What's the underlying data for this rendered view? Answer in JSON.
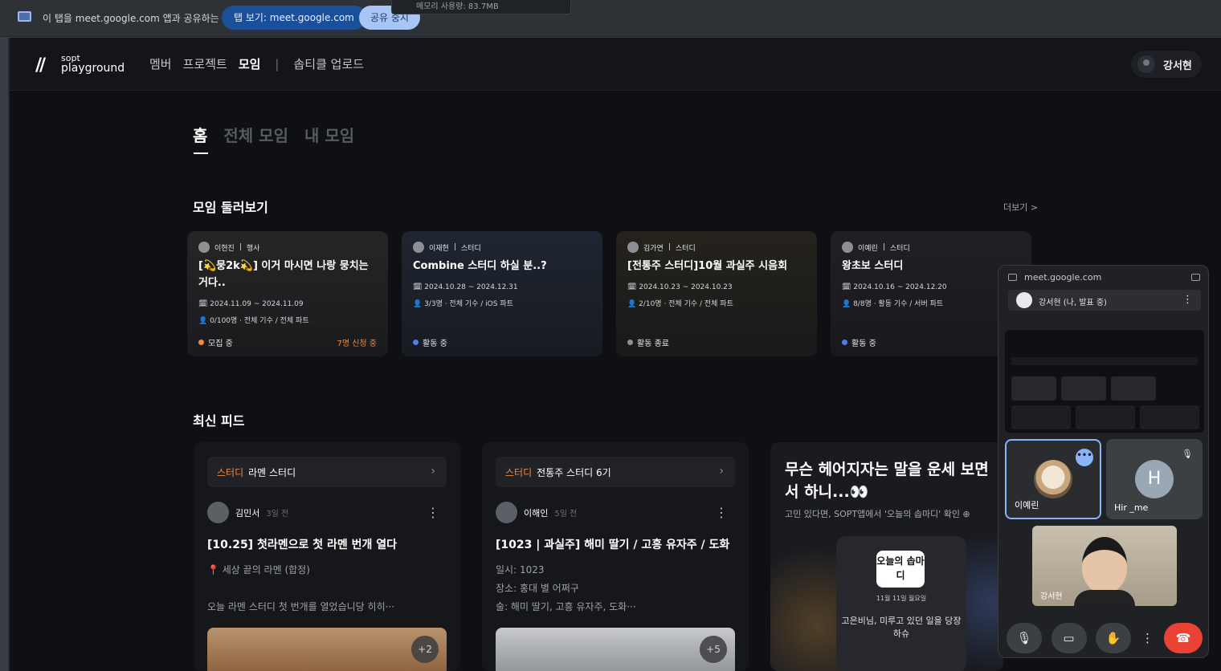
{
  "share_bar": {
    "text": "이 탭을 meet.google.com 앱과 공유하는 중",
    "view_tab_button": "탭 보기: meet.google.com",
    "stop_button": "공유 중지",
    "memory_tooltip": "메모리 사용량: 83.7MB"
  },
  "nav": {
    "logo_top": "sopt",
    "logo_bottom": "playground",
    "items": [
      "멤버",
      "프로젝트",
      "모임",
      "|",
      "솝티클 업로드"
    ],
    "active": "모임",
    "user_name": "강서현"
  },
  "tabs": [
    "홈",
    "전체 모임",
    "내 모임"
  ],
  "groups_section": {
    "title": "모임 둘러보기",
    "more": "더보기 >",
    "cards": [
      {
        "author": "이현진",
        "category": "행사",
        "title": "[💫뭉2k💫] 이거 마시면 나랑 뭉치는 거다..",
        "dates": "2024.11.09 ~ 2024.11.09",
        "members": "0/100명 · 전체 기수 / 전체 파트",
        "status": "모집 중",
        "status_color": "#f28a3a",
        "apply": "7명 신청 중",
        "bg": "#3b3a36"
      },
      {
        "author": "이재현",
        "category": "스터디",
        "title": "Combine 스터디 하실 분..?",
        "dates": "2024.10.28 ~ 2024.12.31",
        "members": "3/3명 · 전체 기수 / iOS 파트",
        "status": "활동 중",
        "status_color": "#4d7cf2",
        "apply": "",
        "bg": "#2c3a4f"
      },
      {
        "author": "김가연",
        "category": "스터디",
        "title": "[전통주 스터디]10월 과실주 시음회",
        "dates": "2024.10.23 ~ 2024.10.23",
        "members": "2/10명 · 전체 기수 / 전체 파트",
        "status": "활동 종료",
        "status_color": "#8e9198",
        "apply": "",
        "bg": "#3a3321"
      },
      {
        "author": "이예린",
        "category": "스터디",
        "title": "왕초보 스터디",
        "dates": "2024.10.16 ~ 2024.12.20",
        "members": "8/8명 · 활동 기수 / 서버 파트",
        "status": "활동 중",
        "status_color": "#4d7cf2",
        "apply": "",
        "bg": "#2d2f36"
      }
    ]
  },
  "feed_section": {
    "title": "최신 피드",
    "posts": [
      {
        "category": "스터디",
        "group": "라멘 스터디",
        "author": "김민서",
        "ago": "3일 전",
        "title": "[10.25] 첫라멘으로 첫 라멘 번개 열다",
        "line1": "📍 세상 끝의 라멘 (합정)",
        "line2": "오늘 라멘 스터디 첫 번개를 열었습니당 히히···",
        "line3": "",
        "plus": "+2"
      },
      {
        "category": "스터디",
        "group": "전통주 스터디 6기",
        "author": "이해인",
        "ago": "5일 전",
        "title": "[1023 | 과실주] 해미 딸기 / 고흥 유자주 / 도화",
        "line1": "일시: 1023",
        "line2": "장소: 홍대 별 어쩌구",
        "line3": "술: 해미 딸기, 고흥 유자주, 도화···",
        "plus": "+5"
      }
    ],
    "ad": {
      "headline": "무슨 헤어지자는 말을 운세 보면서 하니...👀",
      "sub": "고민 있다면, SOPT앱에서 '오늘의 솝마디' 확인 ⊕",
      "badge": "오늘의 솝마디",
      "date": "11월 11일 월요일",
      "message": "고은비님, 미루고 있던 일을 당장 하슈"
    }
  },
  "meet": {
    "url": "meet.google.com",
    "presenter": "강서현 (나, 발표 중)",
    "tiles": [
      {
        "name": "이예린",
        "initial": ""
      },
      {
        "name": "Hir _me",
        "initial": "H"
      }
    ],
    "self_label": "강서현",
    "controls": [
      "mic",
      "camera",
      "raise-hand",
      "more",
      "end-call"
    ]
  }
}
